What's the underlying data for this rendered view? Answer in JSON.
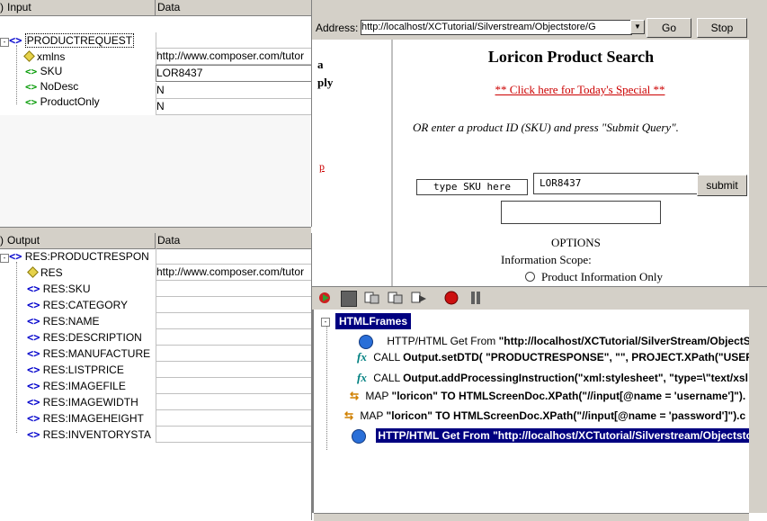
{
  "input_panel": {
    "col_input": "Input",
    "col_data": "Data",
    "rows": [
      {
        "name": "PRODUCTREQUEST",
        "value": ""
      },
      {
        "name": "xmlns",
        "value": "http://www.composer.com/tutor"
      },
      {
        "name": "SKU",
        "value": "LOR8437"
      },
      {
        "name": "NoDesc",
        "value": "N"
      },
      {
        "name": "ProductOnly",
        "value": "N"
      }
    ]
  },
  "output_panel": {
    "col_output": "Output",
    "col_data": "Data",
    "rows": [
      {
        "name": "RES:PRODUCTRESPON",
        "value": ""
      },
      {
        "name": "RES",
        "value": "http://www.composer.com/tutor"
      },
      {
        "name": "RES:SKU",
        "value": ""
      },
      {
        "name": "RES:CATEGORY",
        "value": ""
      },
      {
        "name": "RES:NAME",
        "value": ""
      },
      {
        "name": "RES:DESCRIPTION",
        "value": ""
      },
      {
        "name": "RES:MANUFACTURE",
        "value": ""
      },
      {
        "name": "RES:LISTPRICE",
        "value": ""
      },
      {
        "name": "RES:IMAGEFILE",
        "value": ""
      },
      {
        "name": "RES:IMAGEWIDTH",
        "value": ""
      },
      {
        "name": "RES:IMAGEHEIGHT",
        "value": ""
      },
      {
        "name": "RES:INVENTORYSTA",
        "value": ""
      }
    ]
  },
  "browser": {
    "address_label": "Address:",
    "address_value": "http://localhost/XCTutorial/Silverstream/Objectstore/G",
    "go_label": "Go",
    "stop_label": "Stop",
    "left_frame_text_1": "a",
    "left_frame_text_2": "ply",
    "left_frame_text_3": "p",
    "page_title": "Loricon Product Search",
    "special_link": "** Click here for Today's Special **",
    "instructions": "OR enter a product ID (SKU) and press \"Submit Query\".",
    "sku_label": "type SKU here",
    "sku_value": "LOR8437",
    "submit_label": "submit",
    "options_heading": "OPTIONS",
    "info_scope": "Information Scope:",
    "radio_label": "Product Information Only"
  },
  "actions": {
    "root": "HTMLFrames",
    "items": [
      {
        "prefix": "HTTP/HTML Get From ",
        "rest": "\"http://localhost/XCTutorial/SilverStream/ObjectS"
      },
      {
        "prefix": "CALL ",
        "rest": "Output.setDTD( \"PRODUCTRESPONSE\", \"\", PROJECT.XPath(\"USER("
      },
      {
        "prefix": "CALL ",
        "rest": "Output.addProcessingInstruction(\"xml:stylesheet\", \"type=\\\"text/xsl"
      },
      {
        "prefix": "MAP ",
        "rest": "\"loricon\" TO HTMLScreenDoc.XPath(\"//input[@name = 'username']\")."
      },
      {
        "prefix": "MAP ",
        "rest": "\"loricon\" TO HTMLScreenDoc.XPath(\"//input[@name = 'password']\").c"
      },
      {
        "prefix": "",
        "rest": "HTTP/HTML Get From \"http://localhost/XCTutorial/Silverstream/Objectstor"
      }
    ]
  },
  "colors": {
    "accent_blue": "#0000cc",
    "tag_green": "#009900",
    "selection": "#000080",
    "link_red": "#cc0000"
  }
}
